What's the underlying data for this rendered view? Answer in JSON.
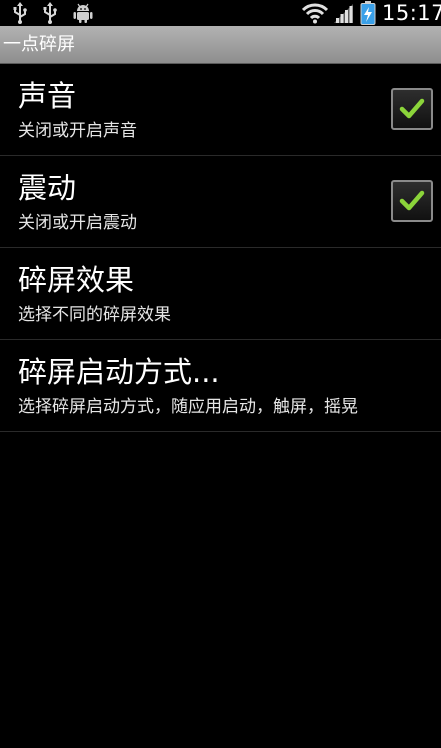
{
  "status_bar": {
    "left_icons": [
      "usb-icon",
      "usb-icon",
      "android-icon"
    ],
    "right_icons": [
      "wifi-icon",
      "signal-icon",
      "battery-charging-icon"
    ],
    "time": "15:17"
  },
  "app": {
    "title": "一点碎屏"
  },
  "preferences": [
    {
      "title": "声音",
      "summary": "关闭或开启声音",
      "checked": true
    },
    {
      "title": "震动",
      "summary": "关闭或开启震动",
      "checked": true
    },
    {
      "title": "碎屏效果",
      "summary": "选择不同的碎屏效果"
    },
    {
      "title": "碎屏启动方式...",
      "summary": "选择碎屏启动方式，随应用启动，触屏，摇晃"
    }
  ],
  "colors": {
    "background": "#000000",
    "title_bar": "#9e9e9e",
    "check_mark": "#8bd43a",
    "divider": "#2a2a2a"
  }
}
